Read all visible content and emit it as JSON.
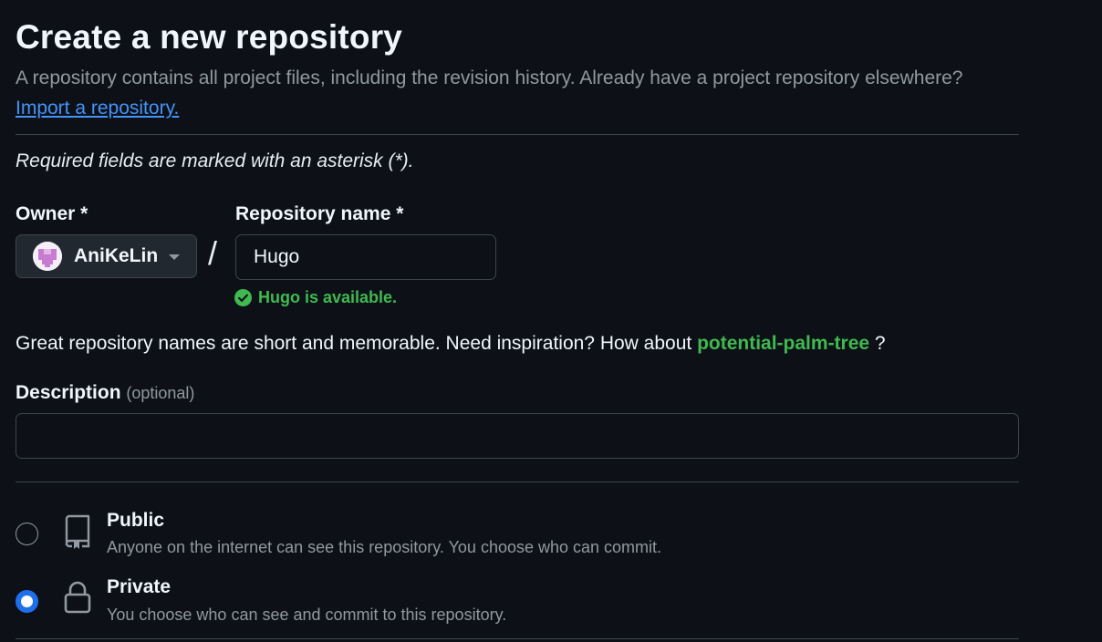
{
  "header": {
    "title": "Create a new repository",
    "subtitle": "A repository contains all project files, including the revision history. Already have a project repository elsewhere?",
    "import_link": "Import a repository."
  },
  "form": {
    "required_note": "Required fields are marked with an asterisk (*).",
    "owner": {
      "label": "Owner *",
      "value": "AniKeLin"
    },
    "separator": "/",
    "repo_name": {
      "label": "Repository name *",
      "value": "Hugo",
      "availability": "Hugo is available."
    },
    "suggestion": {
      "prefix": "Great repository names are short and memorable. Need inspiration? How about",
      "name": "potential-palm-tree",
      "suffix": " ?"
    },
    "description": {
      "label": "Description",
      "optional": "(optional)",
      "value": ""
    },
    "visibility": {
      "selected": "private",
      "options": [
        {
          "id": "public",
          "title": "Public",
          "description": "Anyone on the internet can see this repository. You choose who can commit.",
          "icon": "repo-icon"
        },
        {
          "id": "private",
          "title": "Private",
          "description": "You choose who can see and commit to this repository.",
          "icon": "lock-icon"
        }
      ]
    }
  },
  "colors": {
    "background": "#0d1117",
    "link": "#4493f8",
    "success": "#3fb950",
    "radio_selected": "#1f6feb",
    "border": "#3d444d",
    "muted": "#9198a1"
  }
}
